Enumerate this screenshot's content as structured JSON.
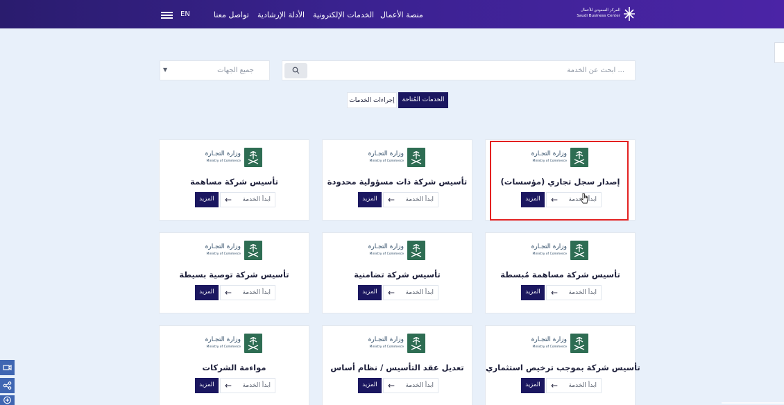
{
  "header": {
    "brand_ar": "المركز السعودي للأعمال",
    "brand_en": "Saudi Business Center",
    "nav": [
      {
        "label": "منصة الأعمال"
      },
      {
        "label": "الخدمات الإلكترونية"
      },
      {
        "label": "الأدلة الإرشادية"
      },
      {
        "label": "تواصل معنا"
      }
    ],
    "lang": "EN"
  },
  "search": {
    "placeholder": "ابحث عن الخدمة ...",
    "filter_value": "جميع الجهات"
  },
  "tabs": [
    {
      "label": "الخدمات المُتاحة",
      "active": true
    },
    {
      "label": "إجراءات الخدمات",
      "active": false
    }
  ],
  "ministry": {
    "ar": "وزارة التجـارة",
    "en": "Ministry of Commerce"
  },
  "card_actions": {
    "start": "ابدأ الخدمة",
    "more": "المزيد"
  },
  "cards": [
    {
      "title": "إصدار سجل تجاري (مؤسسات)",
      "highlighted": true
    },
    {
      "title": "تأسيس شركة ذات مسؤولية محدودة"
    },
    {
      "title": "تأسيس شركة مساهمة"
    },
    {
      "title": "تأسيس شركة مساهمة مُبسطة"
    },
    {
      "title": "تأسيس شركة تضامنية"
    },
    {
      "title": "تأسيس شركة توصية بسيطة"
    },
    {
      "title": "تأسيس شركة بموجب ترخيص استثماري"
    },
    {
      "title": "تعديل عقد التأسيس / نظام أساس"
    },
    {
      "title": "مواءمة الشركات"
    }
  ],
  "colors": {
    "header": "#2a1c6e",
    "accent": "#1b1760",
    "background": "#e8f0fa",
    "emblem": "#2e6d53",
    "highlight": "#e32121"
  },
  "icons": [
    "menu-icon",
    "search-icon",
    "arrow-left-icon",
    "video-icon",
    "share-icon",
    "plus-circle-icon",
    "pointer-cursor-icon"
  ]
}
